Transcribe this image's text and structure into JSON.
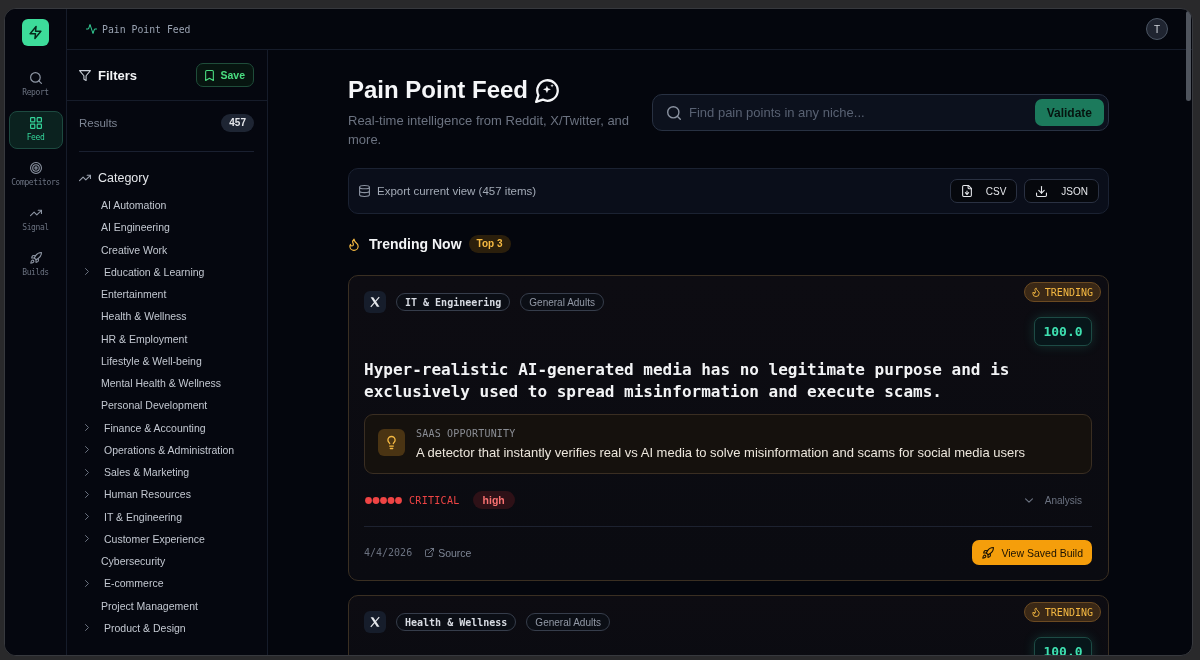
{
  "rail": {
    "items": [
      {
        "label": "Report",
        "selected": false
      },
      {
        "label": "Feed",
        "selected": true
      },
      {
        "label": "Competitors",
        "selected": false
      },
      {
        "label": "Signal",
        "selected": false
      },
      {
        "label": "Builds",
        "selected": false
      }
    ]
  },
  "topbar": {
    "breadcrumb": "Pain Point Feed",
    "avatar": "T"
  },
  "filters": {
    "title": "Filters",
    "save": "Save",
    "results_label": "Results",
    "results_count": "457",
    "category": {
      "title": "Category",
      "items": [
        {
          "label": "AI Automation",
          "expandable": false
        },
        {
          "label": "AI Engineering",
          "expandable": false
        },
        {
          "label": "Creative Work",
          "expandable": false
        },
        {
          "label": "Education & Learning",
          "expandable": true
        },
        {
          "label": "Entertainment",
          "expandable": false
        },
        {
          "label": "Health & Wellness",
          "expandable": false
        },
        {
          "label": "HR & Employment",
          "expandable": false
        },
        {
          "label": "Lifestyle & Well-being",
          "expandable": false
        },
        {
          "label": "Mental Health & Wellness",
          "expandable": false
        },
        {
          "label": "Personal Development",
          "expandable": false
        },
        {
          "label": "Finance & Accounting",
          "expandable": true
        },
        {
          "label": "Operations & Administration",
          "expandable": true
        },
        {
          "label": "Sales & Marketing",
          "expandable": true
        },
        {
          "label": "Human Resources",
          "expandable": true
        },
        {
          "label": "IT & Engineering",
          "expandable": true
        },
        {
          "label": "Customer Experience",
          "expandable": true
        },
        {
          "label": "Cybersecurity",
          "expandable": false
        },
        {
          "label": "E-commerce",
          "expandable": true
        },
        {
          "label": "Project Management",
          "expandable": false
        },
        {
          "label": "Product & Design",
          "expandable": true
        }
      ]
    }
  },
  "header": {
    "title": "Pain Point Feed",
    "subtitle": "Real-time intelligence from Reddit, X/Twitter, and more.",
    "search": {
      "placeholder": "Find pain points in any niche...",
      "button": "Validate"
    }
  },
  "export": {
    "label": "Export current view (457 items)",
    "buttons": [
      "CSV",
      "JSON"
    ]
  },
  "trending": {
    "title": "Trending Now",
    "badge": "Top 3"
  },
  "cards": [
    {
      "category": "IT & Engineering",
      "audience": "General Adults",
      "trending": "TRENDING",
      "score": "100.0",
      "title": "Hyper-realistic AI-generated media has no legitimate purpose and is exclusively used to spread misinformation and execute scams.",
      "opportunity": {
        "label": "SAAS OPPORTUNITY",
        "text": "A detector that instantly verifies real vs AI media to solve misinformation and scams for social media users"
      },
      "severity": {
        "stars": 5,
        "label": "CRITICAL"
      },
      "priority": "high",
      "analysis": "Analysis",
      "date": "4/4/2026",
      "source": "Source",
      "action": "View Saved Build"
    },
    {
      "category": "Health & Wellness",
      "audience": "General Adults",
      "trending": "TRENDING",
      "score": "100.0"
    }
  ]
}
